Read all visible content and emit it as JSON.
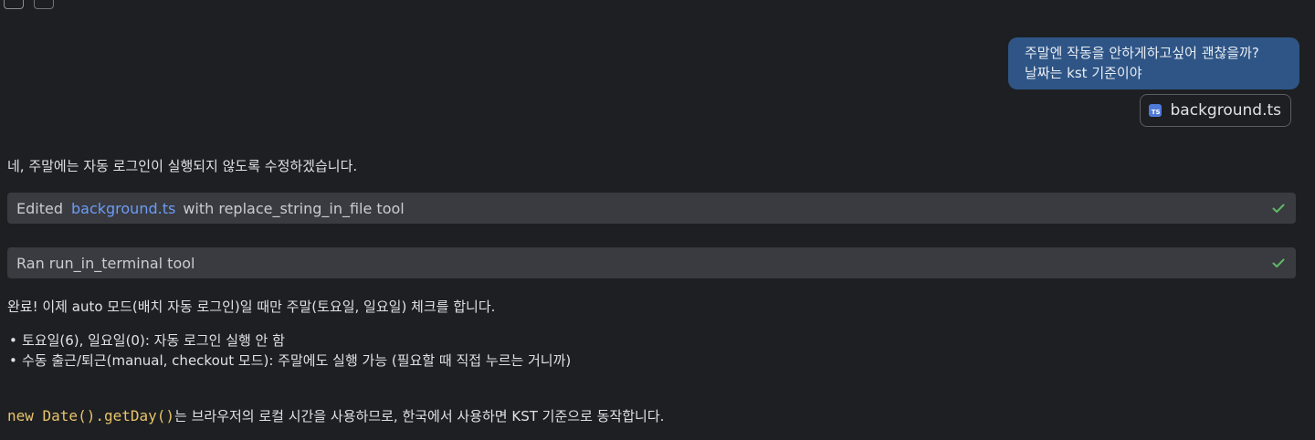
{
  "user_message": {
    "lines": [
      "주말엔 작동을 안하게하고싶어 괜찮을까?",
      "날짜는 kst 기준이야"
    ],
    "attachment": {
      "icon_label": "TS",
      "filename": "background.ts"
    }
  },
  "assistant": {
    "intro": "네, 주말에는 자동 로그인이 실행되지 않도록 수정하겠습니다.",
    "tool_rows": [
      {
        "prefix": "Edited",
        "link": "background.ts",
        "suffix": "with replace_string_in_file tool",
        "status_icon": "check-icon"
      },
      {
        "text": "Ran run_in_terminal tool",
        "status_icon": "check-icon"
      }
    ],
    "summary": "완료! 이제 auto 모드(배치 자동 로그인)일 때만 주말(토요일, 일요일) 체크를 합니다.",
    "bullets": [
      "토요일(6), 일요일(0): 자동 로그인 실행 안 함",
      "수동 출근/퇴근(manual, checkout 모드): 주말에도 실행 가능 (필요할 때 직접 누르는 거니까)"
    ],
    "final_code": "new Date().getDay()",
    "final_text": "는 브라우저의 로컬 시간을 사용하므로, 한국에서 사용하면 KST 기준으로 동작합니다."
  },
  "colors": {
    "background": "#1e1f22",
    "user_bubble": "#2e5586",
    "tool_row": "#393b40",
    "link": "#6d9cf5",
    "check": "#5fb865",
    "code": "#e8c46a"
  }
}
